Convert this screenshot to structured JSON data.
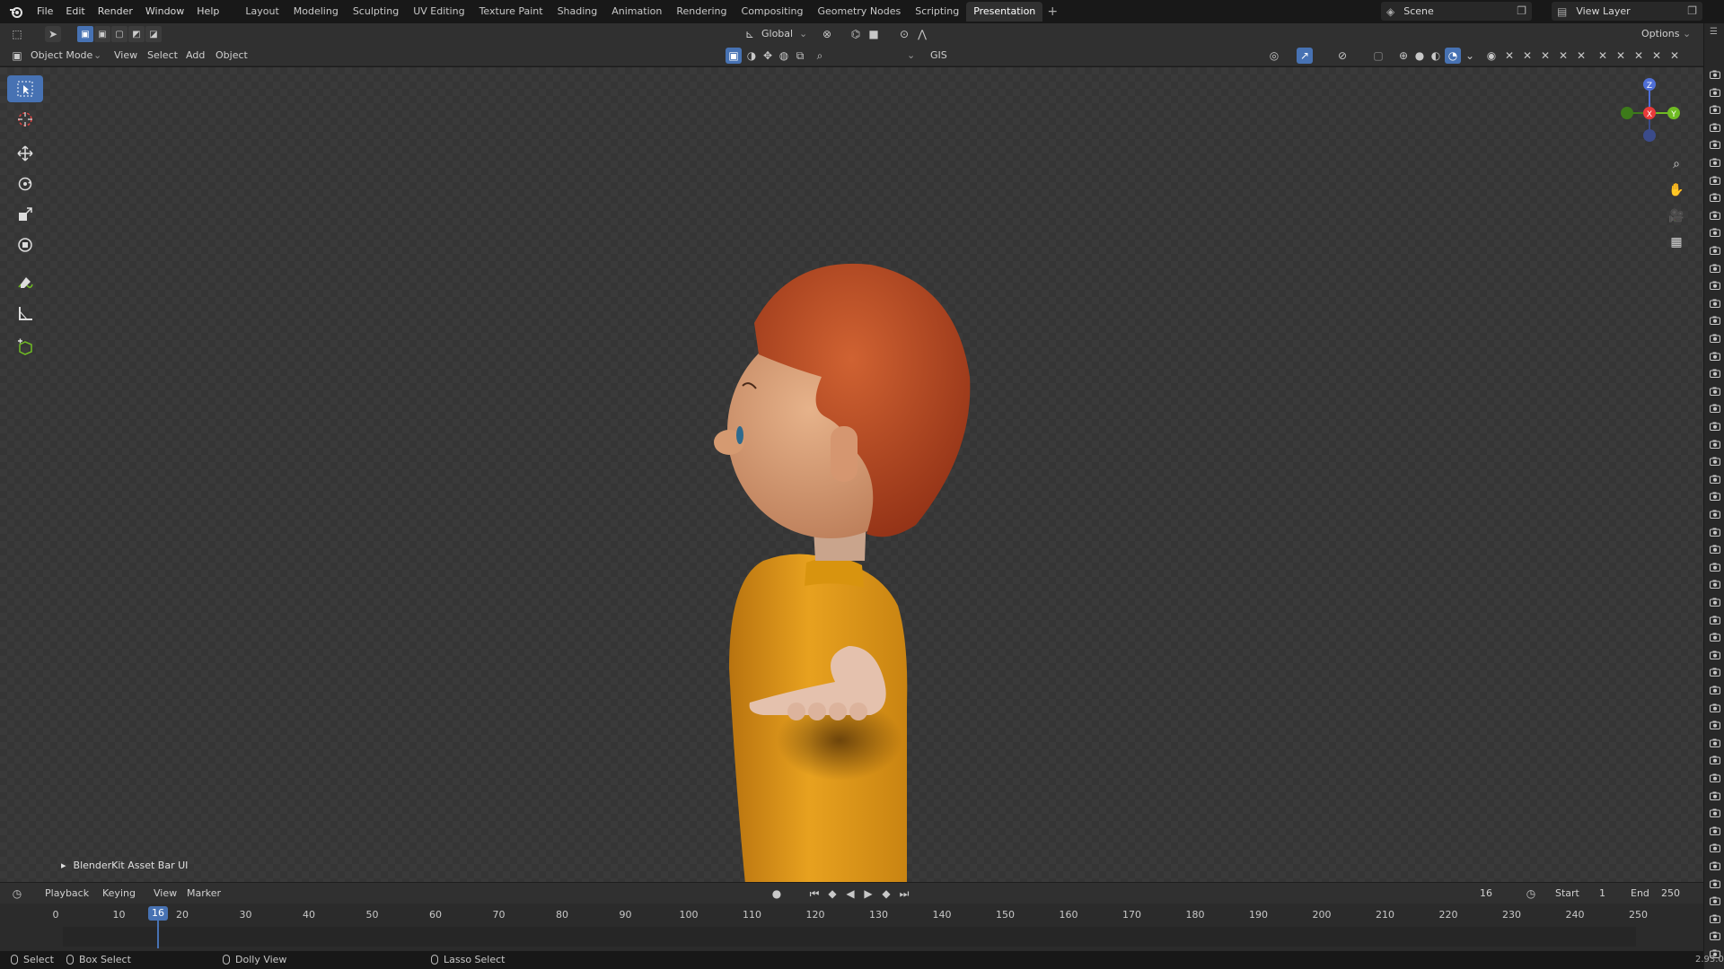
{
  "app": {
    "menus": [
      "File",
      "Edit",
      "Render",
      "Window",
      "Help"
    ],
    "workspaces": [
      "Layout",
      "Modeling",
      "Sculpting",
      "UV Editing",
      "Texture Paint",
      "Shading",
      "Animation",
      "Rendering",
      "Compositing",
      "Geometry Nodes",
      "Scripting",
      "Presentation"
    ],
    "active_workspace": "Presentation",
    "add_workspace": "+",
    "scene": "Scene",
    "view_layer": "View Layer"
  },
  "tool_header": {
    "transform_orientation": "Global",
    "options": "Options"
  },
  "view_header": {
    "mode": "Object Mode",
    "menus": [
      "View",
      "Select",
      "Add",
      "Object"
    ],
    "gis": "GIS"
  },
  "viewport": {
    "asset_bar": "BlenderKit Asset Bar UI",
    "gizmo_axes": {
      "z": "Z",
      "x": "X",
      "y": "Y"
    }
  },
  "timeline": {
    "menus": [
      "Playback",
      "Keying",
      "View",
      "Marker"
    ],
    "current_frame": "16",
    "start_label": "Start",
    "start_value": "1",
    "end_label": "End",
    "end_value": "250",
    "frame_marks": [
      "0",
      "10",
      "20",
      "30",
      "40",
      "50",
      "60",
      "70",
      "80",
      "90",
      "100",
      "110",
      "120",
      "130",
      "140",
      "150",
      "160",
      "170",
      "180",
      "190",
      "200",
      "210",
      "220",
      "230",
      "240",
      "250"
    ],
    "playhead_label": "16"
  },
  "status": {
    "select": "Select",
    "box_select": "Box Select",
    "dolly_view": "Dolly View",
    "lasso_select": "Lasso Select",
    "version": "2.93.0"
  },
  "colors": {
    "accent": "#4772b3",
    "hair": "#c0502a",
    "skin": "#d9a078",
    "shirt": "#e39a1a",
    "axis_x": "#e83a3a",
    "axis_y": "#6fbb23",
    "axis_z": "#4f6fd8"
  },
  "icons": [
    "blender-logo-icon",
    "select-box-icon",
    "cursor-icon",
    "move-icon",
    "rotate-icon",
    "scale-icon",
    "transform-icon",
    "annotate-icon",
    "measure-icon",
    "add-cube-icon",
    "zoom-icon",
    "hand-icon",
    "camera-icon",
    "grid-icon",
    "camera-restrict-icon"
  ]
}
